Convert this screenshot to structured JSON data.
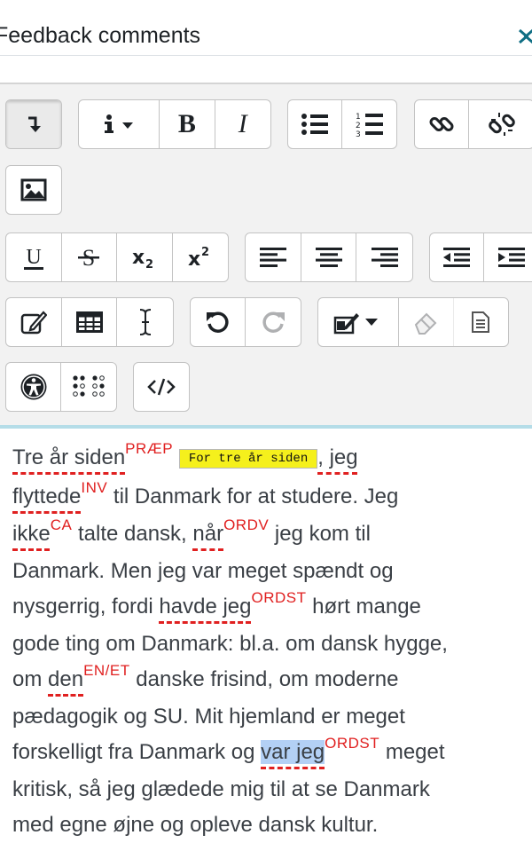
{
  "header": {
    "title": "Feedback comments",
    "collapse_icon": "collapse-arrows-icon"
  },
  "toolbar": {
    "rows": [
      [
        "toolbar-toggle",
        "info-dropdown",
        "bold",
        "italic",
        "bullet-list",
        "numbered-list",
        "link",
        "unlink"
      ],
      [
        "image"
      ],
      [
        "underline",
        "strikethrough",
        "subscript",
        "superscript",
        "align-left",
        "align-center",
        "align-right",
        "outdent",
        "indent"
      ],
      [
        "equation",
        "table",
        "text-cursor",
        "undo",
        "redo",
        "text-marker-dropdown",
        "eraser",
        "paste-plain"
      ],
      [
        "accessibility",
        "braille",
        "html-source"
      ]
    ],
    "labels": {
      "bold": "B",
      "italic": "I"
    }
  },
  "editor": {
    "s1_a": "Tre år siden",
    "s1_tag": "PRÆP",
    "s1_sugg": "For tre år siden",
    "s1_b": ", jeg",
    "s2_a": "flyttede",
    "s2_tag": "INV",
    "s2_b": " til Danmark for at studere. Jeg",
    "s3_a": "ikke",
    "s3_tag": "CA",
    "s3_b": " talte dansk, ",
    "s3_c": "når",
    "s3_tag2": "ORDV",
    "s3_d": " jeg kom til",
    "s4": "Danmark. Men jeg var meget spændt og",
    "s5_a": "nysgerrig, fordi ",
    "s5_b": "havde jeg",
    "s5_tag": "ORDST",
    "s5_c": " hørt mange",
    "s6": "gode ting om Danmark: bl.a. om dansk hygge,",
    "s7_a": "om ",
    "s7_b": "den",
    "s7_tag": "EN/ET",
    "s7_c": " danske frisind, om moderne",
    "s8": "pædagogik og SU. Mit hjemland er meget",
    "s9_a": "forskelligt fra Danmark og ",
    "s9_b": "var jeg",
    "s9_tag": "ORDST",
    "s9_c": " meget",
    "s10": "kritisk, så jeg glædede mig til at se Danmark",
    "s11": "med egne øjne og opleve dansk kultur."
  },
  "colors": {
    "error": "#e02020",
    "suggestion_bg": "#f5f01c",
    "selection": "#b3d0f5",
    "editor_border": "#b5dde8"
  }
}
